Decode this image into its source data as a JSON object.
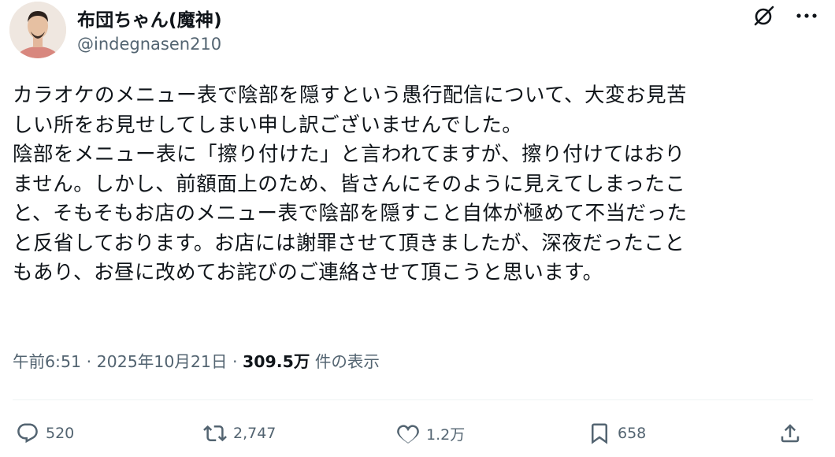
{
  "author": {
    "display_name": "布団ちゃん(魔神)",
    "handle": "@indegnasen210"
  },
  "tweet": {
    "lines": [
      "カラオケのメニュー表で陰部を隠すという愚行配信について、大変お見苦",
      "しい所をお見せしてしまい申し訳ございませんでした。",
      "陰部をメニュー表に「擦り付けた」と言われてますが、擦り付けてはおり",
      "ません。しかし、前額面上のため、皆さんにそのように見えてしまったこ",
      "と、そもそもお店のメニュー表で陰部を隠すこと自体が極めて不当だった",
      "と反省しております。お店には謝罪させて頂きましたが、深夜だったこと",
      "もあり、お昼に改めてお詫びのご連絡させて頂こうと思います。"
    ]
  },
  "meta": {
    "time": "午前6:51",
    "sep1": " · ",
    "date": "2025年10月21日",
    "sep2": " · ",
    "views": "309.5万",
    "views_label": " 件の表示"
  },
  "actions": {
    "replies": "520",
    "reposts": "2,747",
    "likes": "1.2万",
    "bookmarks": "658"
  },
  "icons": {
    "top": [
      "grok-icon",
      "more-icon"
    ],
    "actions": [
      "reply-icon",
      "repost-icon",
      "like-icon",
      "bookmark-icon",
      "share-icon"
    ]
  },
  "colors": {
    "text": "#0f1419",
    "secondary": "#536471",
    "divider": "#eff3f4"
  }
}
